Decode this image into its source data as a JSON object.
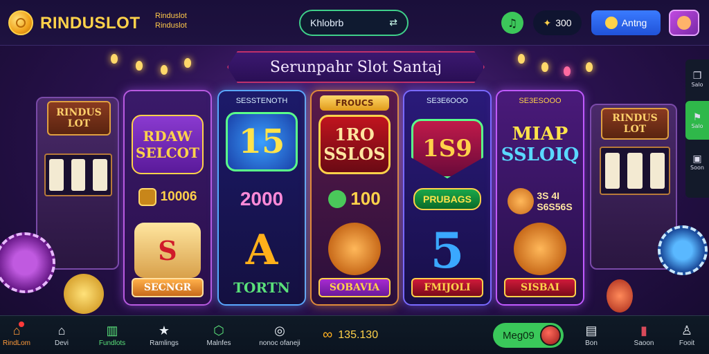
{
  "header": {
    "brand": "RINDUSLOT",
    "brand_sub_1": "Rinduslot",
    "brand_sub_2": "Rinduslot",
    "search_value": "Khlobrb",
    "search_icon": "swap-icon",
    "music_icon": "music-note-icon",
    "balance": "300",
    "rating_label": "Antng",
    "colors": {
      "accent": "#ffd24a",
      "green": "#3cc75a",
      "blue": "#2a64f0"
    }
  },
  "banner": {
    "title": "Serunpahr Slot Santaj"
  },
  "machines": {
    "left_marquee": "RINDUS LOT",
    "right_marquee": "RINDUS LOT"
  },
  "cards": [
    {
      "head": "",
      "title_line1": "RDAW",
      "title_line2": "SELCOT",
      "amount": "10006",
      "art": "S",
      "ribbon": "SECNGR"
    },
    {
      "head": "SESSTENOTH",
      "title_line1": "15",
      "title_line2": "",
      "amount": "2000",
      "art": "A",
      "ribbon": "TORTN"
    },
    {
      "head": "FROUCS",
      "title_line1": "1RO",
      "title_line2": "SSLOS",
      "amount": "100",
      "art": "",
      "ribbon": "SOBAVIA"
    },
    {
      "head": "SE3E6OOO",
      "title_line1": "1S9",
      "title_line2": "",
      "amount": "PRUBAGS",
      "art": "5",
      "ribbon": "FMIJOLI"
    },
    {
      "head": "SE3ESOOO",
      "title_line1": "MIAP",
      "title_line2": "SSLOIQ",
      "amount": "3S 4I",
      "amount2": "S6S56S",
      "art": "",
      "ribbon": "SISBAI"
    }
  ],
  "side_panel": [
    {
      "label": "Salo",
      "icon": "bookmark-icon"
    },
    {
      "label": "Salo",
      "icon": "flag-icon",
      "active": true
    },
    {
      "label": "Soon",
      "icon": "gift-icon"
    }
  ],
  "bottom_nav": {
    "items": [
      {
        "label": "RindLom",
        "icon": "home-icon",
        "active": true
      },
      {
        "label": "Devi",
        "icon": "house-outline-icon"
      },
      {
        "label": "Fundlots",
        "icon": "building-icon",
        "green": true
      },
      {
        "label": "Ramlings",
        "icon": "star-icon"
      },
      {
        "label": "Malnfes",
        "icon": "shield-icon"
      },
      {
        "label": "nonoc ofaneji",
        "icon": "circle-icon"
      }
    ],
    "balance": "135.130",
    "mega_label": "Meg09",
    "right_items": [
      {
        "label": "Bon",
        "icon": "document-icon"
      },
      {
        "label": "Saoon",
        "icon": "cards-icon"
      },
      {
        "label": "Fooit",
        "icon": "user-icon"
      }
    ]
  }
}
